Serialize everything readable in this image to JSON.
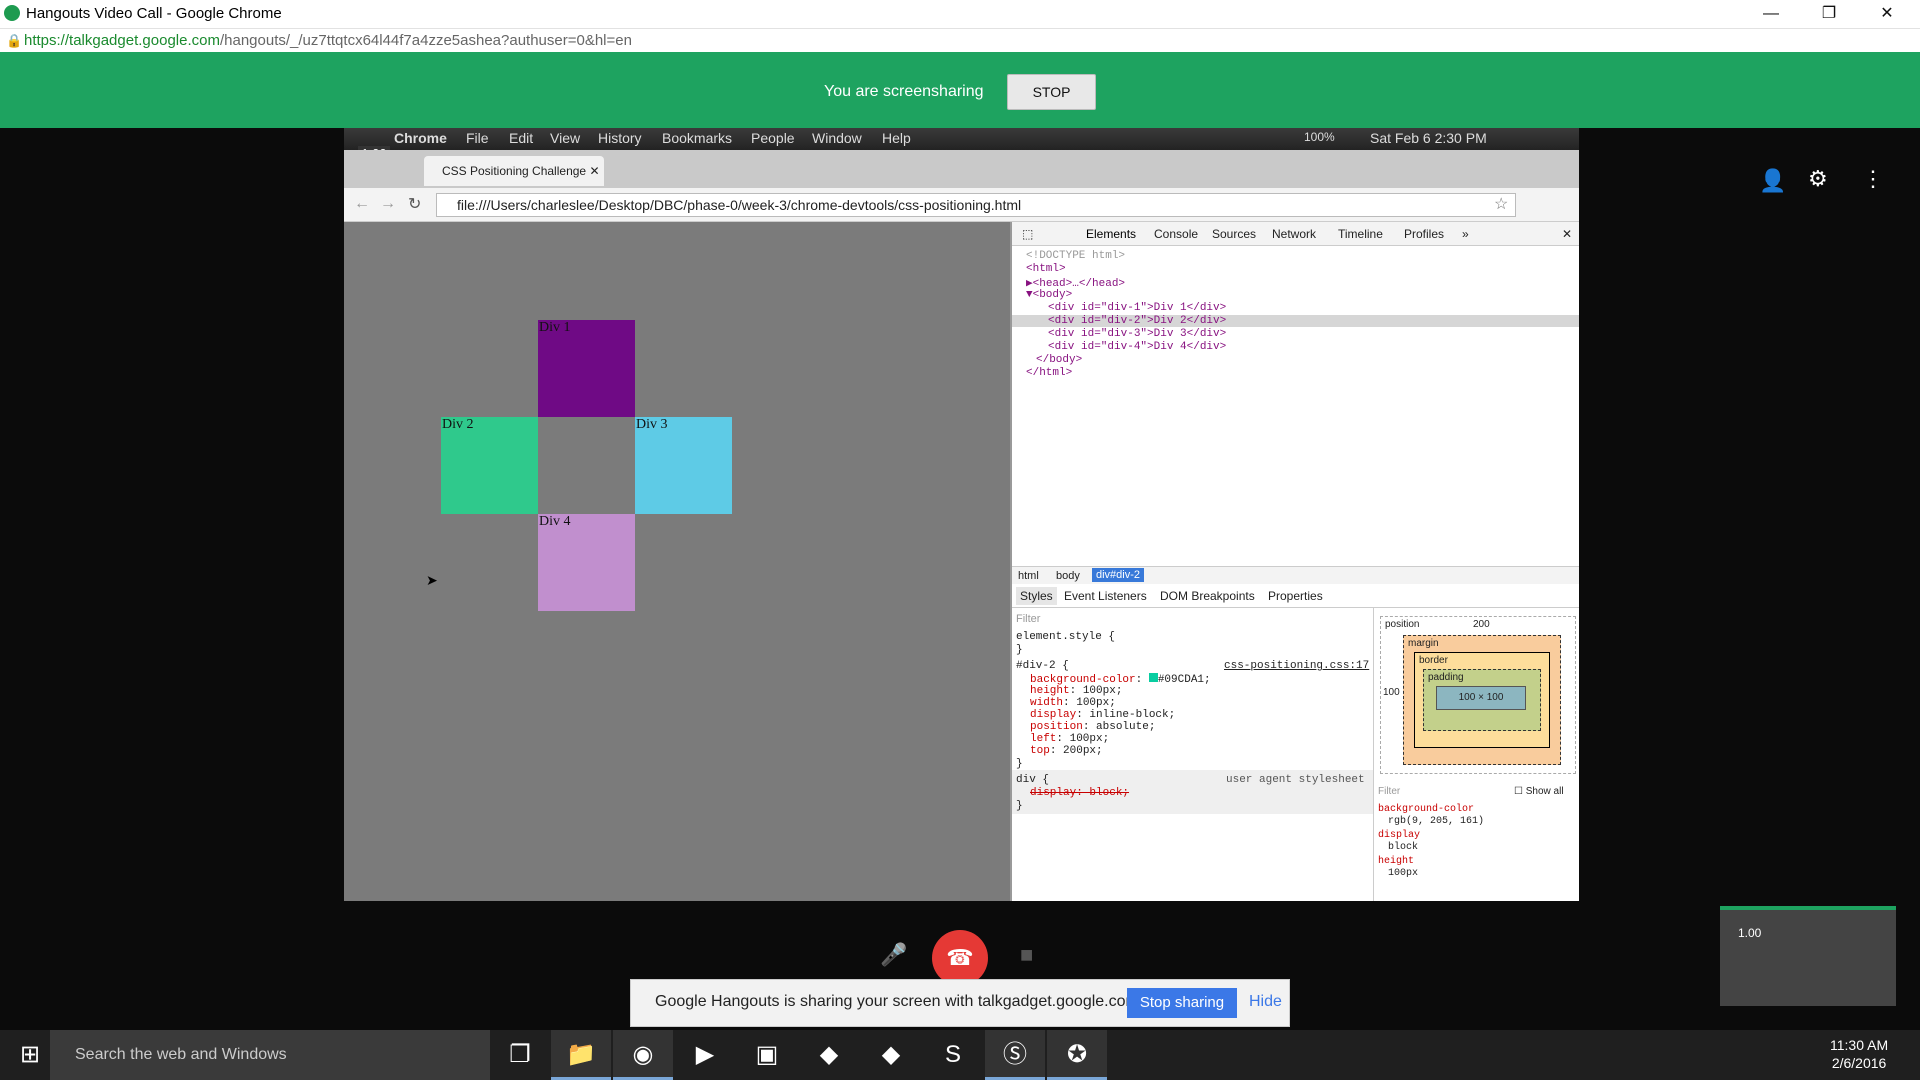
{
  "window": {
    "title": "Hangouts Video Call - Google Chrome",
    "url_host": "https://talkgadget.google.com",
    "url_path": "/hangouts/_/uz7ttqtcx64l44f7a4zze5ashea?authuser=0&hl=en"
  },
  "sharebar": {
    "message": "You are screensharing",
    "stop_label": "STOP"
  },
  "remote": {
    "zoom": "1.00",
    "mac_menu": [
      "Chrome",
      "File",
      "Edit",
      "View",
      "History",
      "Bookmarks",
      "People",
      "Window",
      "Help"
    ],
    "status_right": "Sat Feb 6  2:30 PM",
    "battery": "100%",
    "tab_title": "CSS Positioning Challenge",
    "address": "file:///Users/charleslee/Desktop/DBC/phase-0/week-3/chrome-devtools/css-positioning.html",
    "divs": [
      {
        "label": "Div 1",
        "color": "#6f0a85"
      },
      {
        "label": "Div 2",
        "color": "#2fc98c"
      },
      {
        "label": "Div 3",
        "color": "#5ecbe6"
      },
      {
        "label": "Div 4",
        "color": "#c18fce"
      }
    ],
    "devtools": {
      "tabs": [
        "Elements",
        "Console",
        "Sources",
        "Network",
        "Timeline",
        "Profiles",
        "»"
      ],
      "dom": [
        "<!DOCTYPE html>",
        "<html>",
        "▶<head>…</head>",
        "▼<body>",
        "<div id=\"div-1\">Div 1</div>",
        "<div id=\"div-2\">Div 2</div>",
        "<div id=\"div-3\">Div 3</div>",
        "<div id=\"div-4\">Div 4</div>",
        "</body>",
        "</html>"
      ],
      "crumbs": [
        "html",
        "body",
        "div#div-2"
      ],
      "subtabs": [
        "Styles",
        "Event Listeners",
        "DOM Breakpoints",
        "Properties"
      ],
      "filter": "Filter",
      "element_style": "element.style {",
      "rule_selector": "#div-2 {",
      "rule_source": "css-positioning.css:17",
      "decls": [
        [
          "background-color",
          "#09CDA1;"
        ],
        [
          "height",
          "100px;"
        ],
        [
          "width",
          "100px;"
        ],
        [
          "display",
          "inline-block;"
        ],
        [
          "position",
          "absolute;"
        ],
        [
          "left",
          "100px;"
        ],
        [
          "top",
          "200px;"
        ]
      ],
      "ua_selector": "div {",
      "ua_source": "user agent stylesheet",
      "ua_decl": "display: block;",
      "close_brace": "}",
      "metrics": {
        "position": "position",
        "position_val": "200",
        "margin": "margin",
        "border": "border",
        "padding": "padding",
        "content": "100 × 100",
        "left": "100",
        "dash": "-"
      },
      "computed_filter": "Filter",
      "show_all": "Show all",
      "computed": [
        [
          "background-color",
          "rgb(9, 205, 161)"
        ],
        [
          "display",
          "block"
        ],
        [
          "height",
          "100px"
        ]
      ]
    }
  },
  "notification": {
    "text": "Google Hangouts is sharing your screen with talkgadget.google.com.",
    "stop": "Stop sharing",
    "hide": "Hide"
  },
  "thumb_zoom": "1.00",
  "taskbar": {
    "search": "Search the web and Windows",
    "time": "11:30 AM",
    "date": "2/6/2016"
  }
}
